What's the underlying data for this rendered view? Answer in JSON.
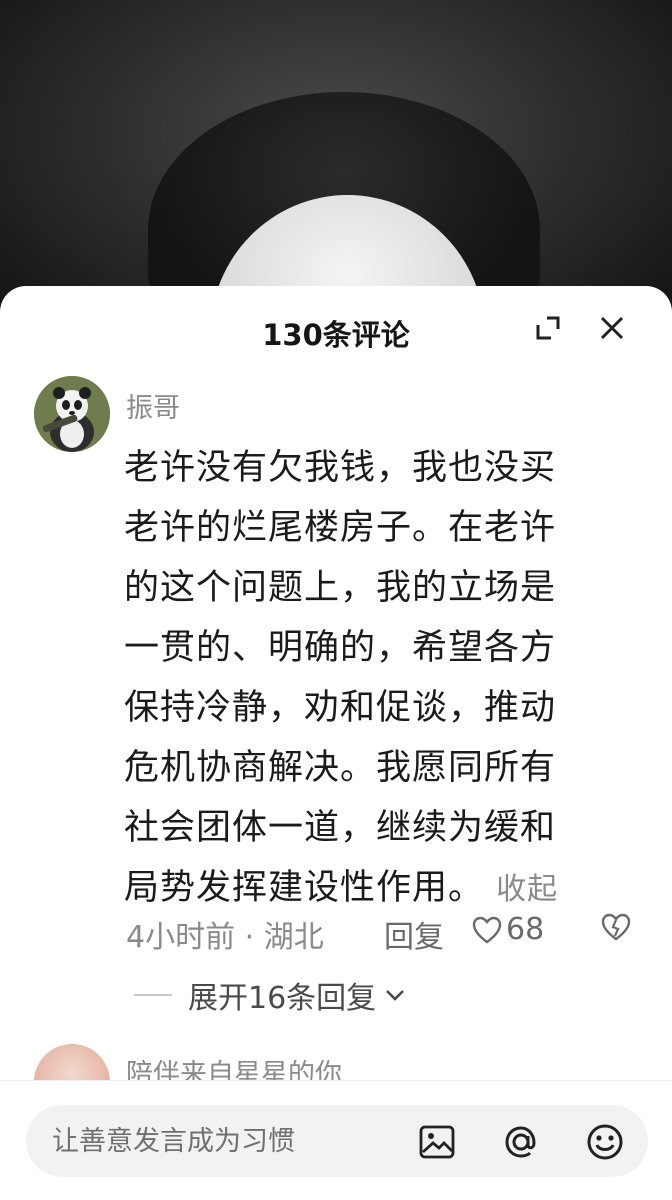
{
  "sheet": {
    "title": "130条评论"
  },
  "comment": {
    "author": "振哥",
    "text": "老许没有欠我钱，我也没买\n老许的烂尾楼房子。在老许\n的这个问题上，我的立场是\n一贯的、明确的，希望各方\n保持冷静，劝和促谈，推动\n危机协商解决。我愿同所有\n社会团体一道，继续为缓和\n局势发挥建设性作用。",
    "collapse_label": "收起",
    "time_location": "4小时前 · 湖北",
    "reply_label": "回复",
    "like_count": "68",
    "expand_replies_label": "展开16条回复"
  },
  "next_comment": {
    "author": "陪伴来自星星的你"
  },
  "input": {
    "placeholder": "让善意发言成为习惯"
  },
  "icons": {
    "expand": "expand-icon",
    "close": "close-icon",
    "heart": "heart-icon",
    "broken_heart": "dislike-heart-icon",
    "chevron": "chevron-down-icon",
    "image": "image-icon",
    "at": "at-icon",
    "emoji": "emoji-icon"
  }
}
